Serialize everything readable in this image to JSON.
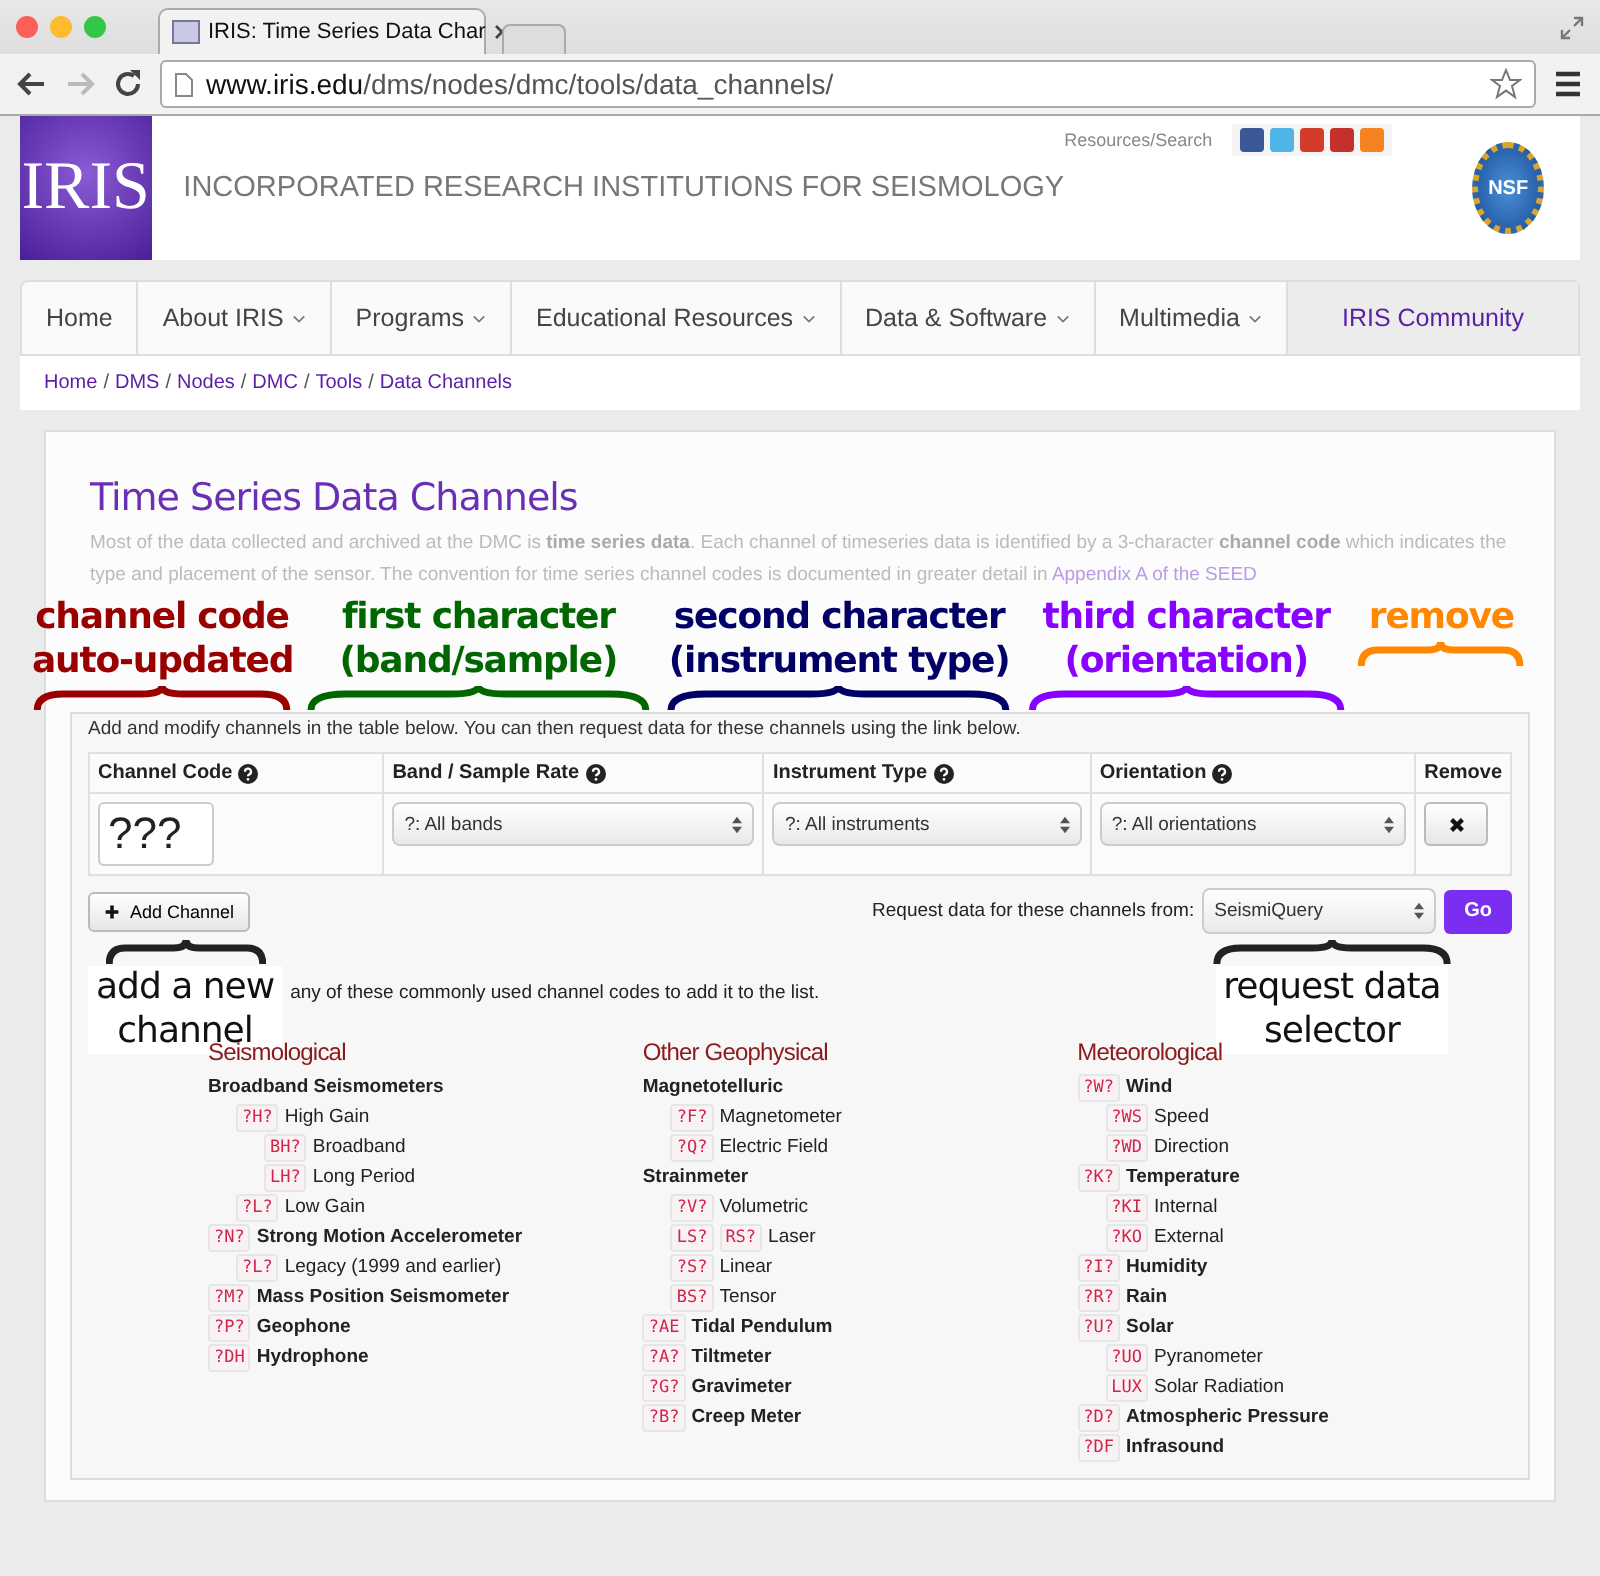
{
  "browser": {
    "tab_title": "IRIS: Time Series Data Char",
    "url_host": "www.iris.edu",
    "url_path": "/dms/nodes/dmc/tools/data_channels/"
  },
  "header": {
    "logo": "IRIS",
    "title": "INCORPORATED RESEARCH INSTITUTIONS FOR SEISMOLOGY",
    "utility_link": "Resources/Search",
    "nsf_logo": "NSF"
  },
  "nav": [
    {
      "label": "Home",
      "dropdown": false,
      "selected": false
    },
    {
      "label": "About IRIS",
      "dropdown": true,
      "selected": false
    },
    {
      "label": "Programs",
      "dropdown": true,
      "selected": false
    },
    {
      "label": "Educational Resources",
      "dropdown": true,
      "selected": false
    },
    {
      "label": "Data & Software",
      "dropdown": true,
      "selected": false
    },
    {
      "label": "Multimedia",
      "dropdown": true,
      "selected": false
    },
    {
      "label": "IRIS Community",
      "dropdown": false,
      "selected": true
    }
  ],
  "breadcrumb": {
    "separator": "/",
    "items": [
      "Home",
      "DMS",
      "Nodes",
      "DMC",
      "Tools",
      "Data Channels"
    ]
  },
  "page_title": "Time Series Data Channels",
  "intro": {
    "text": "Most of the data collected and archived at the DMC is **time series data**. Each channel of timeseries data is identified by a 3-character **channel code** which indicates the type and placement of the sensor. The convention for time series channel codes is documented in greater detail in",
    "link": "Appendix A of the SEED"
  },
  "top_annotations": [
    {
      "lines": [
        "channel code",
        "auto-updated"
      ],
      "color": "#990000"
    },
    {
      "lines": [
        "first character",
        "(band/sample)"
      ],
      "color": "#006600"
    },
    {
      "lines": [
        "second character",
        "(instrument type)"
      ],
      "color": "#000066"
    },
    {
      "lines": [
        "third character",
        "(orientation)"
      ],
      "color": "#8800ff"
    },
    {
      "lines": [
        "remove"
      ],
      "color": "#ff8800"
    }
  ],
  "panel": {
    "instructions": "Add and modify channels in the table below. You can then request data for these channels using the link below.",
    "columns": [
      {
        "label": "Channel Code",
        "help": true
      },
      {
        "label": "Band / Sample Rate",
        "help": true
      },
      {
        "label": "Instrument Type",
        "help": true
      },
      {
        "label": "Orientation",
        "help": true
      },
      {
        "label": "Remove",
        "help": false
      }
    ],
    "row": {
      "code": "???",
      "band": "?: All bands",
      "instrument": "?: All instruments",
      "orientation": "?: All orientations"
    },
    "add_button": "Add Channel",
    "request_label": "Request data for these channels from:",
    "request_select": "SeismiQuery",
    "go_button": "Go"
  },
  "bottom_annotations": [
    {
      "lines": [
        "add a new",
        "channel"
      ]
    },
    {
      "lines": [
        "request data",
        "selector"
      ]
    }
  ],
  "hint": "any of these commonly used channel codes to add it to the list.",
  "categories": [
    {
      "title": "Seismological",
      "items": [
        {
          "label": "Broadband Seismometers",
          "children": [
            {
              "codes": [
                "?H?"
              ],
              "label": "High Gain",
              "children": [
                {
                  "codes": [
                    "BH?"
                  ],
                  "label": "Broadband"
                },
                {
                  "codes": [
                    "LH?"
                  ],
                  "label": "Long Period"
                }
              ]
            },
            {
              "codes": [
                "?L?"
              ],
              "label": "Low Gain"
            }
          ]
        },
        {
          "codes": [
            "?N?"
          ],
          "label": "Strong Motion Accelerometer",
          "children": [
            {
              "codes": [
                "?L?"
              ],
              "label": "Legacy (1999 and earlier)"
            }
          ]
        },
        {
          "codes": [
            "?M?"
          ],
          "label": "Mass Position Seismometer"
        },
        {
          "codes": [
            "?P?"
          ],
          "label": "Geophone"
        },
        {
          "codes": [
            "?DH"
          ],
          "label": "Hydrophone"
        }
      ]
    },
    {
      "title": "Other Geophysical",
      "items": [
        {
          "label": "Magnetotelluric",
          "children": [
            {
              "codes": [
                "?F?"
              ],
              "label": "Magnetometer"
            },
            {
              "codes": [
                "?Q?"
              ],
              "label": "Electric Field"
            }
          ]
        },
        {
          "label": "Strainmeter",
          "children": [
            {
              "codes": [
                "?V?"
              ],
              "label": "Volumetric"
            },
            {
              "codes": [
                "LS?",
                "RS?"
              ],
              "label": "Laser"
            },
            {
              "codes": [
                "?S?"
              ],
              "label": "Linear"
            },
            {
              "codes": [
                "BS?"
              ],
              "label": "Tensor"
            }
          ]
        },
        {
          "codes": [
            "?AE"
          ],
          "label": "Tidal Pendulum"
        },
        {
          "codes": [
            "?A?"
          ],
          "label": "Tiltmeter"
        },
        {
          "codes": [
            "?G?"
          ],
          "label": "Gravimeter"
        },
        {
          "codes": [
            "?B?"
          ],
          "label": "Creep Meter"
        }
      ]
    },
    {
      "title": "Meteorological",
      "items": [
        {
          "codes": [
            "?W?"
          ],
          "label": "Wind",
          "children": [
            {
              "codes": [
                "?WS"
              ],
              "label": "Speed"
            },
            {
              "codes": [
                "?WD"
              ],
              "label": "Direction"
            }
          ]
        },
        {
          "codes": [
            "?K?"
          ],
          "label": "Temperature",
          "children": [
            {
              "codes": [
                "?KI"
              ],
              "label": "Internal"
            },
            {
              "codes": [
                "?KO"
              ],
              "label": "External"
            }
          ]
        },
        {
          "codes": [
            "?I?"
          ],
          "label": "Humidity"
        },
        {
          "codes": [
            "?R?"
          ],
          "label": "Rain"
        },
        {
          "codes": [
            "?U?"
          ],
          "label": "Solar",
          "children": [
            {
              "codes": [
                "?UO"
              ],
              "label": "Pyranometer"
            },
            {
              "codes": [
                "LUX"
              ],
              "label": "Solar Radiation"
            }
          ]
        },
        {
          "codes": [
            "?D?"
          ],
          "label": "Atmospheric Pressure"
        },
        {
          "codes": [
            "?DF"
          ],
          "label": "Infrasound"
        }
      ]
    }
  ]
}
